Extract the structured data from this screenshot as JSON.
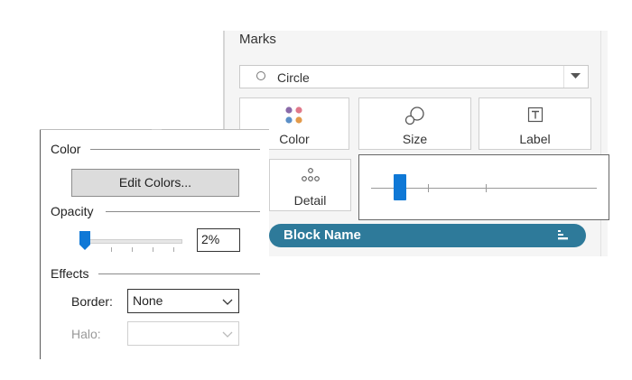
{
  "marks": {
    "title": "Marks",
    "mark_type": {
      "icon": "circle-outline-icon",
      "label": "Circle"
    },
    "shelves": [
      {
        "id": "color",
        "label": "Color",
        "icon": "color-dots-icon"
      },
      {
        "id": "size",
        "label": "Size",
        "icon": "size-circles-icon"
      },
      {
        "id": "label",
        "label": "Label",
        "icon": "text-box-icon"
      },
      {
        "id": "detail",
        "label": "Detail",
        "icon": "detail-dots-icon"
      }
    ],
    "size_slider": {
      "value_fraction": 0.13,
      "tick_count": 3
    },
    "pill": {
      "label": "Block Name",
      "icon": "sort-bars-icon",
      "color": "#2e7a9a"
    }
  },
  "color_popup": {
    "color_section": "Color",
    "edit_colors_label": "Edit Colors...",
    "opacity_section": "Opacity",
    "opacity_value": "2%",
    "opacity_fraction": 0.02,
    "effects_section": "Effects",
    "border_label": "Border:",
    "border_value": "None",
    "halo_label": "Halo:",
    "halo_value": ""
  },
  "colors": {
    "accent_blue": "#0f78d6",
    "pill_teal": "#2e7a9a",
    "dot_purple": "#8a6aa8",
    "dot_pink": "#e0788a",
    "dot_blue": "#5b8fc7",
    "dot_orange": "#e39a4a"
  }
}
